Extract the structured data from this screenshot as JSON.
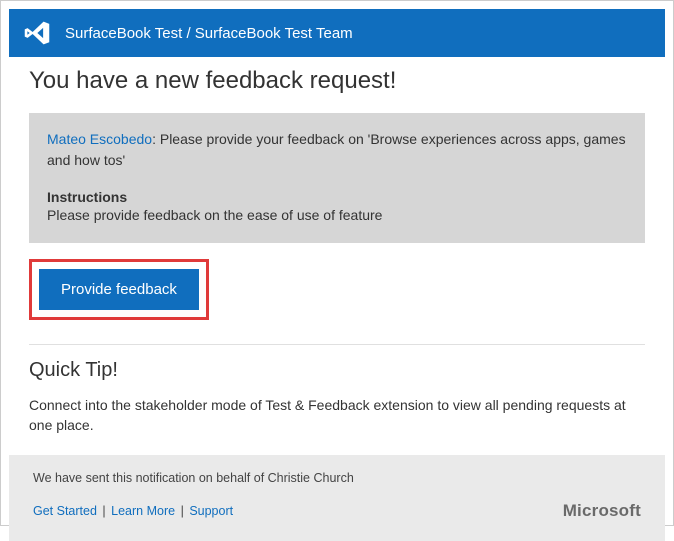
{
  "header": {
    "breadcrumb": "SurfaceBook Test / SurfaceBook Test Team"
  },
  "title": "You have a new feedback request!",
  "request": {
    "requester_name": "Mateo Escobedo",
    "message": ": Please provide your feedback on 'Browse experiences across  apps, games and how tos'",
    "instructions_label": "Instructions",
    "instructions_text": "Please provide feedback on the ease of use of feature"
  },
  "cta": {
    "label": "Provide feedback"
  },
  "tip": {
    "title": "Quick Tip!",
    "text": "Connect into the stakeholder mode of Test & Feedback extension to view all pending requests at one place."
  },
  "footer": {
    "note_prefix": "We have sent this notification on behalf of  ",
    "note_sender": "Christie Church",
    "links": {
      "get_started": "Get Started",
      "learn_more": "Learn More",
      "support": "Support"
    },
    "brand": "Microsoft"
  }
}
